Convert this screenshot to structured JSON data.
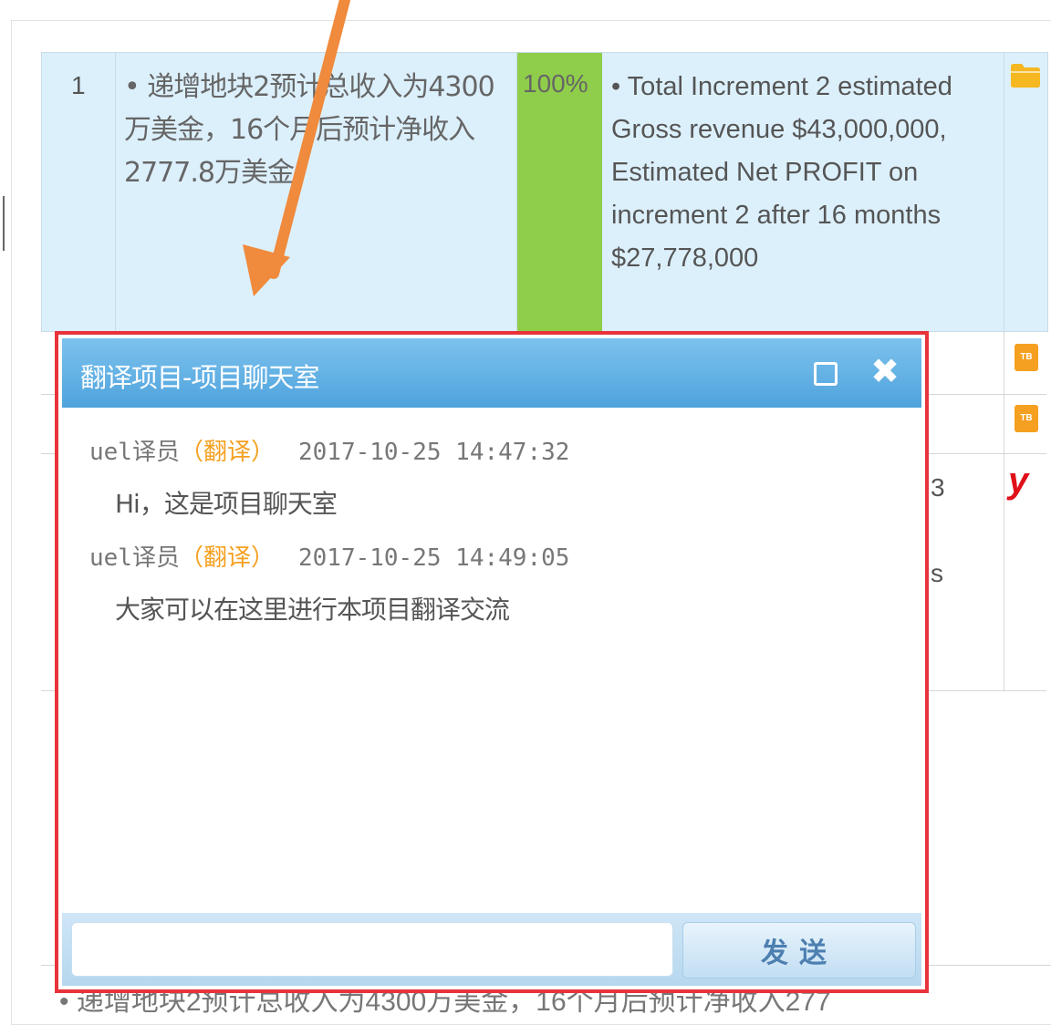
{
  "table": {
    "row1": {
      "index": "1",
      "source": "• 递增地块2预计总收入为4300万美金，16个月后预计净收入2777.8万美金",
      "match": "100%",
      "target": "• Total Increment 2 estimated Gross revenue $43,000,000, Estimated Net PROFIT on increment 2 after 16 months $27,778,000"
    },
    "fragments": [
      "3",
      "s"
    ],
    "tb_label": "TB",
    "y_icon": "y",
    "bottom_text": "• 递增地块2预计总收入为4300万美金，16个月后预计净收入277"
  },
  "chat": {
    "title": "翻译项目-项目聊天室",
    "messages": [
      {
        "user": "uel译员",
        "role": "（翻译）",
        "time": "2017-10-25 14:47:32",
        "text": "Hi，这是项目聊天室"
      },
      {
        "user": "uel译员",
        "role": "（翻译）",
        "time": "2017-10-25 14:49:05",
        "text": "大家可以在这里进行本项目翻译交流"
      }
    ],
    "input_value": "",
    "send_label": "发送"
  },
  "colors": {
    "highlight_border": "#e8333a",
    "arrow": "#f08a3c",
    "match_green": "#8fce4a",
    "role_orange": "#f5a020"
  }
}
